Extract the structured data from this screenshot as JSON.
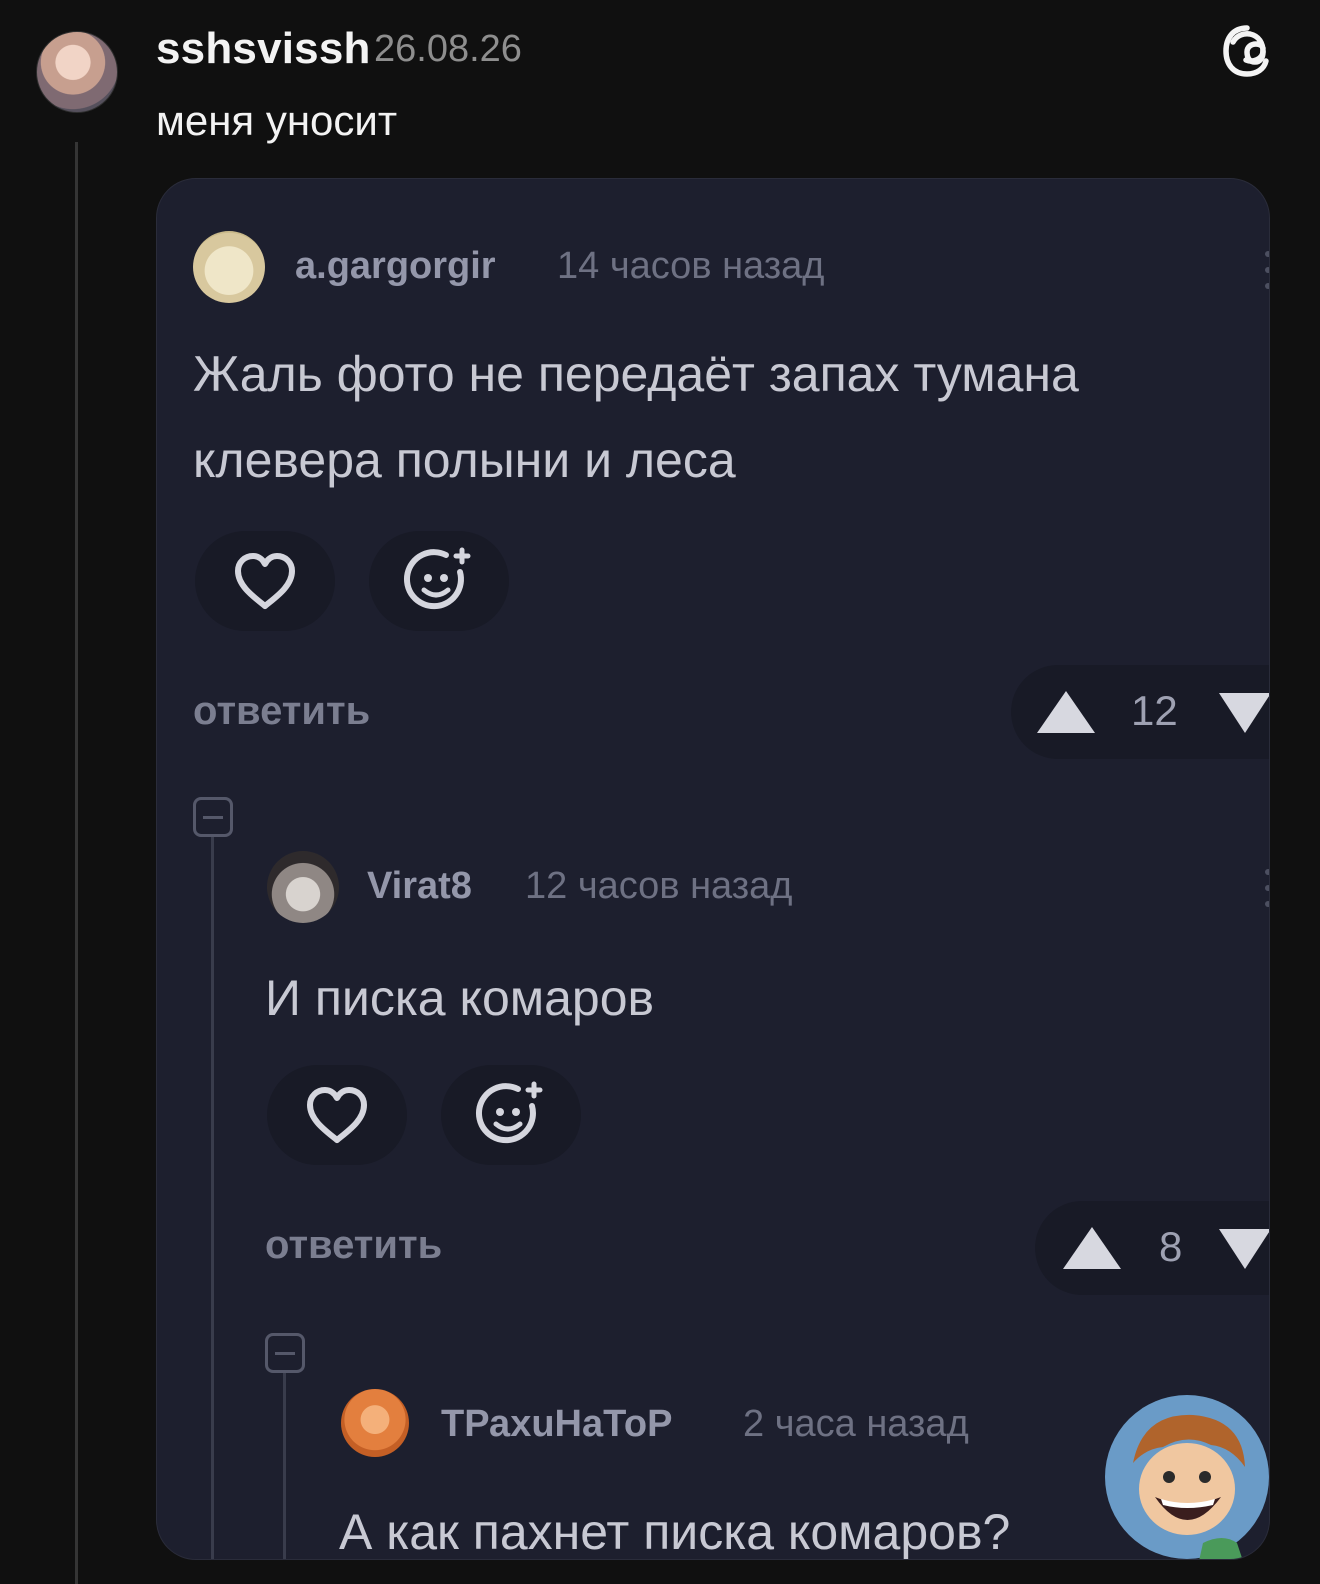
{
  "post": {
    "author": "sshsvissh",
    "date": "26.08.26",
    "text": "меня уносит"
  },
  "screenshot": {
    "comments": [
      {
        "user": "a.gargorgir",
        "time": "14 часов назад",
        "text_lines": [
          "Жаль фото не передаёт запах тумана",
          "клевера полыни и леса"
        ],
        "reply_label": "ответить",
        "votes": "12"
      },
      {
        "user": "Virat8",
        "time": "12 часов назад",
        "text": "И писка комаров",
        "reply_label": "ответить",
        "votes": "8"
      },
      {
        "user": "ТРахuНаТоР",
        "time": "2 часа назад",
        "text": "А как пахнет писка комаров?"
      }
    ]
  },
  "icons": {
    "threads": "threads-logo-icon",
    "like": "heart-icon",
    "reaction": "smiley-add-icon",
    "upvote": "triangle-up-icon",
    "downvote": "triangle-down-icon",
    "collapse": "collapse-minus-icon",
    "more": "dots-vertical-icon"
  },
  "colors": {
    "background": "#101010",
    "card_background": "#1d1f2e"
  }
}
